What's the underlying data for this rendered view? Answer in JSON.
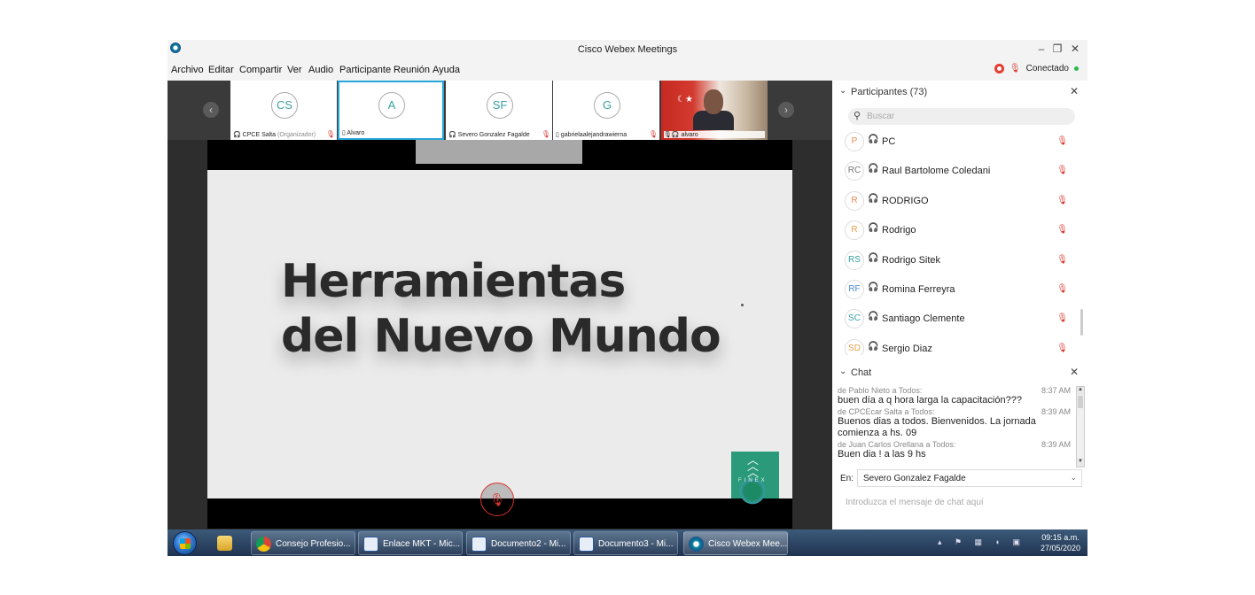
{
  "window": {
    "title": "Cisco Webex Meetings",
    "controls": [
      "–",
      "❐",
      "✕"
    ]
  },
  "menu": [
    "Archivo",
    "Editar",
    "Compartir",
    "Ver",
    "Audio",
    "Participante",
    "Reunión",
    "Ayuda"
  ],
  "status": {
    "label": "Conectado"
  },
  "thumbnails": [
    {
      "initials": "CS",
      "name": "CPCE Salta",
      "role": "(Organizador)"
    },
    {
      "initials": "A",
      "name": "Alvaro"
    },
    {
      "initials": "SF",
      "name": "Severo Gonzalez Fagalde"
    },
    {
      "initials": "G",
      "name": "gabrielaalejandrawierna"
    },
    {
      "name": "alvaro"
    }
  ],
  "slide": {
    "line1": "Herramientas",
    "line2": "del Nuevo Mundo",
    "logo_text": "FINEX"
  },
  "participants": {
    "header": "Participantes (73)",
    "search_placeholder": "Buscar",
    "items": [
      {
        "initials": "P",
        "name": "PC",
        "color": "#e8885a"
      },
      {
        "initials": "RC",
        "name": "Raul Bartolome Coledani",
        "color": "#777777"
      },
      {
        "initials": "R",
        "name": "RODRIGO",
        "color": "#e8885a"
      },
      {
        "initials": "R",
        "name": "Rodrigo",
        "color": "#e8a04a"
      },
      {
        "initials": "RS",
        "name": "Rodrigo Sitek",
        "color": "#3aa0a0"
      },
      {
        "initials": "RF",
        "name": "Romina Ferreyra",
        "color": "#4a8ad0"
      },
      {
        "initials": "SC",
        "name": "Santiago Clemente",
        "color": "#3aa0a0"
      },
      {
        "initials": "SD",
        "name": "Sergio Diaz",
        "color": "#e8a04a"
      }
    ]
  },
  "chat": {
    "header": "Chat",
    "messages": [
      {
        "from": "de Pablo Nieto a Todos:",
        "time": "8:37 AM",
        "text": "buen día a q hora larga la capacitación???"
      },
      {
        "from": "de CPCEcar Salta a Todos:",
        "time": "8:39 AM",
        "text": "Buenos dias a todos. Bienvenidos.  La jornada comienza a hs. 09"
      },
      {
        "from": "de Juan Carlos Orellana a Todos:",
        "time": "8:39 AM",
        "text": "Buen dia ! a las 9 hs"
      }
    ],
    "to_label": "En:",
    "to_value": "Severo Gonzalez Fagalde",
    "input_placeholder": "Introduzca el mensaje de chat aquí"
  },
  "taskbar": {
    "items": [
      {
        "label": "Consejo Profesio...",
        "icon": "chrome-icon"
      },
      {
        "label": "Enlace MKT - Mic...",
        "icon": "word-icon"
      },
      {
        "label": "Documento2 - Mi...",
        "icon": "word-icon"
      },
      {
        "label": "Documento3 - Mi...",
        "icon": "word-icon"
      },
      {
        "label": "Cisco Webex Mee...",
        "icon": "webex-icon"
      }
    ],
    "time": "09:15 a.m.",
    "date": "27/05/2020"
  },
  "colors": {
    "accent": "#27a6d8",
    "mic_muted": "#d9342b",
    "connected": "#2ab84b",
    "slide_logo": "#2a9a7a"
  }
}
